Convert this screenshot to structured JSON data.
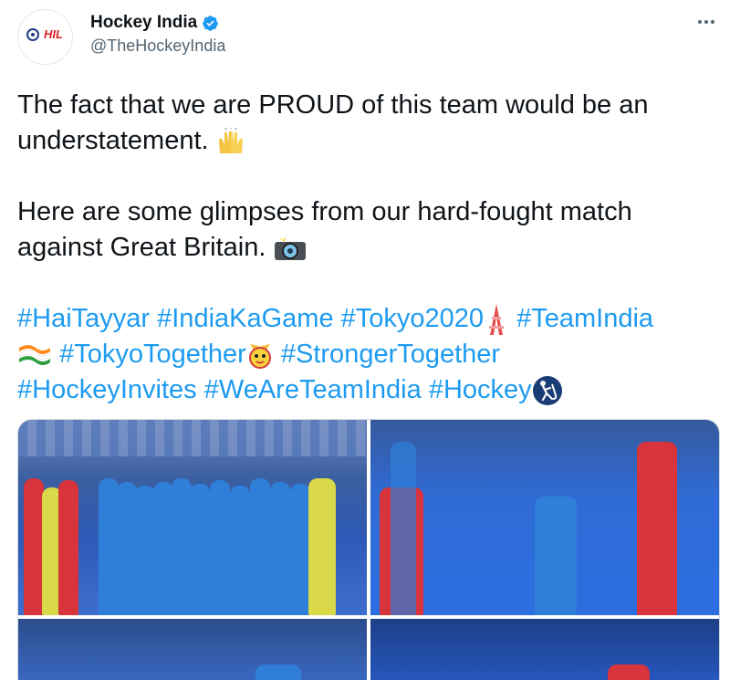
{
  "account": {
    "display_name": "Hockey India",
    "handle": "@TheHockeyIndia",
    "verified": true,
    "avatar_logo_text": "HIL"
  },
  "tweet": {
    "line1": "The fact that we are PROUD of this team would be an understatement.",
    "line2": "Here are some glimpses from our hard-fought match against Great Britain.",
    "hashtags": [
      "#HaiTayyar",
      "#IndiaKaGame",
      "#Tokyo2020",
      "#TeamIndia",
      "#TokyoTogether",
      "#StrongerTogether",
      "#HockeyInvites",
      "#WeAreTeamIndia",
      "#Hockey"
    ]
  },
  "icons": {
    "more": "more-options-icon",
    "verified": "verified-badge-icon"
  },
  "colors": {
    "link": "#1d9bf0",
    "text": "#0f1419",
    "secondary": "#536471",
    "verified": "#1d9bf0"
  }
}
